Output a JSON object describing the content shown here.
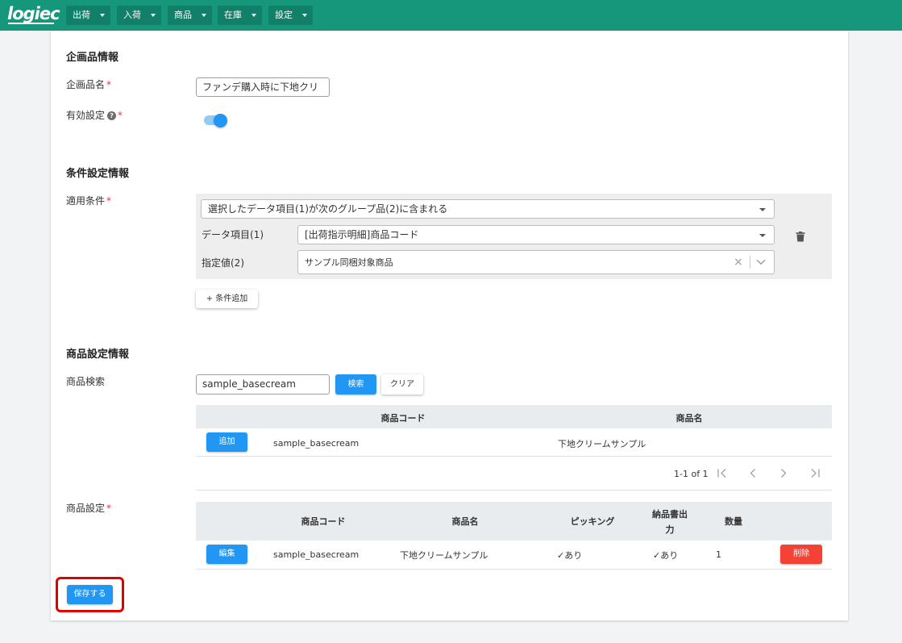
{
  "app": {
    "logo": "logiec",
    "nav": [
      {
        "label": "出荷"
      },
      {
        "label": "入荷"
      },
      {
        "label": "商品"
      },
      {
        "label": "在庫"
      },
      {
        "label": "設定"
      }
    ]
  },
  "campaign": {
    "section_title": "企画品情報",
    "name_label": "企画品名",
    "name_value": "ファンデ購入時に下地クリ",
    "active_label": "有効設定",
    "active_on": true,
    "required_mark": "*",
    "help_glyph": "?"
  },
  "conditions": {
    "section_title": "条件設定情報",
    "apply_label": "適用条件",
    "condition_select": "選択したデータ項目(1)が次のグループ品(2)に含まれる",
    "data_item_label": "データ項目(1)",
    "data_item_value": "[出荷指示明細]商品コード",
    "spec_value_label": "指定値(2)",
    "spec_value": "サンプル同梱対象商品",
    "clear_glyph": "×",
    "delete_icon": "trash-icon",
    "add_button": "+ 条件追加"
  },
  "products": {
    "section_title": "商品設定情報",
    "search_label": "商品検索",
    "search_value": "sample_basecream",
    "search_button": "検索",
    "clear_button": "クリア",
    "result_headers": [
      "商品コード",
      "商品名"
    ],
    "result_rows": [
      {
        "action": "追加",
        "code": "sample_basecream",
        "name": "下地クリームサンプル"
      }
    ],
    "pagination": "1-1 of 1",
    "settings_label": "商品設定",
    "settings_headers": {
      "code": "商品コード",
      "name": "商品名",
      "picking": "ピッキング",
      "invoice_line1": "納品書出",
      "invoice_line2": "力",
      "qty": "数量"
    },
    "settings_rows": [
      {
        "edit": "編集",
        "code": "sample_basecream",
        "name": "下地クリームサンプル",
        "picking": "✓あり",
        "invoice": "✓あり",
        "qty": "1",
        "delete": "削除"
      }
    ]
  },
  "save_button": "保存する",
  "colors": {
    "topbar": "#16977c",
    "primary": "#2196f3",
    "danger": "#f44336",
    "highlight": "#e00000"
  }
}
